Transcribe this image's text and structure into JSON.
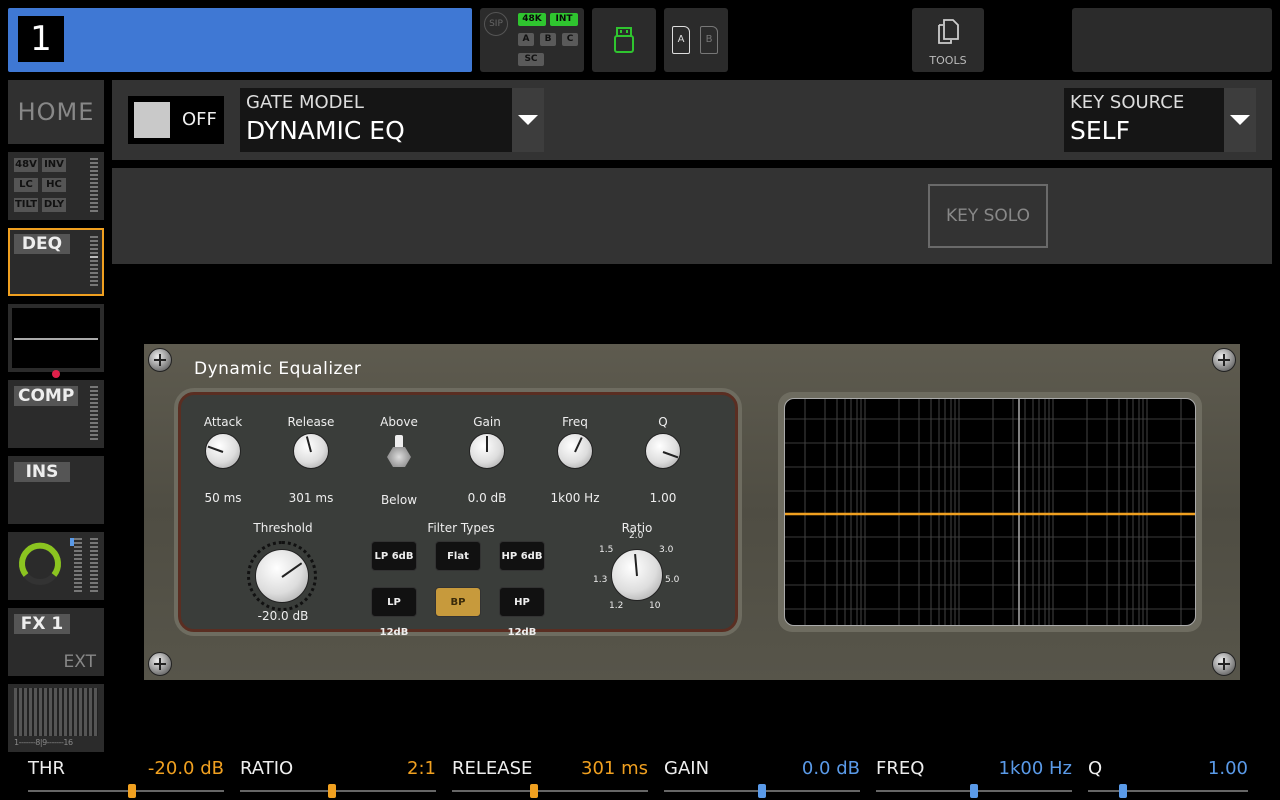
{
  "channel": {
    "number": "1"
  },
  "status": {
    "sip_label": "SIP",
    "tags": [
      "48K",
      "INT",
      "A",
      "B",
      "C",
      "SC"
    ],
    "card_a": "A",
    "card_b": "B",
    "tools_label": "TOOLS"
  },
  "sidebar": {
    "home": "HOME",
    "input_tags": [
      "48V",
      "INV",
      "LC",
      "HC",
      "TILT",
      "DLY"
    ],
    "deq": "DEQ",
    "comp": "COMP",
    "ins": "INS",
    "fx": "FX 1",
    "fx_ext": "EXT",
    "bus_meter_label": "1-------8|9-------16"
  },
  "gate": {
    "toggle_label": "OFF",
    "model_label": "GATE MODEL",
    "model_value": "DYNAMIC EQ",
    "key_source_label": "KEY SOURCE",
    "key_source_value": "SELF",
    "key_solo": "KEY SOLO"
  },
  "plugin": {
    "title": "Dynamic Equalizer",
    "knobs": [
      {
        "label": "Attack",
        "value": "50 ms"
      },
      {
        "label": "Release",
        "value": "301 ms"
      },
      {
        "label": "Gain",
        "value": "0.0 dB"
      },
      {
        "label": "Freq",
        "value": "1k00 Hz"
      },
      {
        "label": "Q",
        "value": "1.00"
      }
    ],
    "switch_top": "Above",
    "switch_bottom": "Below",
    "threshold_label": "Threshold",
    "threshold_value": "-20.0 dB",
    "filter_types_label": "Filter Types",
    "filters": [
      "LP 6dB",
      "Flat",
      "HP 6dB",
      "LP 12dB",
      "BP",
      "HP 12dB"
    ],
    "active_filter": "BP",
    "ratio_label": "Ratio",
    "ratio_ticks": [
      "1.2",
      "1.3",
      "1.5",
      "2.0",
      "3.0",
      "5.0",
      "10"
    ]
  },
  "params": [
    {
      "name": "THR",
      "value": "-20.0 dB",
      "color": "#f0a020",
      "level": 0.53
    },
    {
      "name": "RATIO",
      "value": "2:1",
      "color": "#f0a020",
      "level": 0.47
    },
    {
      "name": "RELEASE",
      "value": "301 ms",
      "color": "#f0a020",
      "level": 0.42
    },
    {
      "name": "GAIN",
      "value": "0.0 dB",
      "color": "#5a9ae8",
      "level": 0.5
    },
    {
      "name": "FREQ",
      "value": "1k00 Hz",
      "color": "#5a9ae8",
      "level": 0.5
    },
    {
      "name": "Q",
      "value": "1.00",
      "color": "#5a9ae8",
      "level": 0.22
    }
  ],
  "colors": {
    "channel_blue": "#3f78d4",
    "selected_border": "#f0a020",
    "curve": "#f0a020"
  }
}
